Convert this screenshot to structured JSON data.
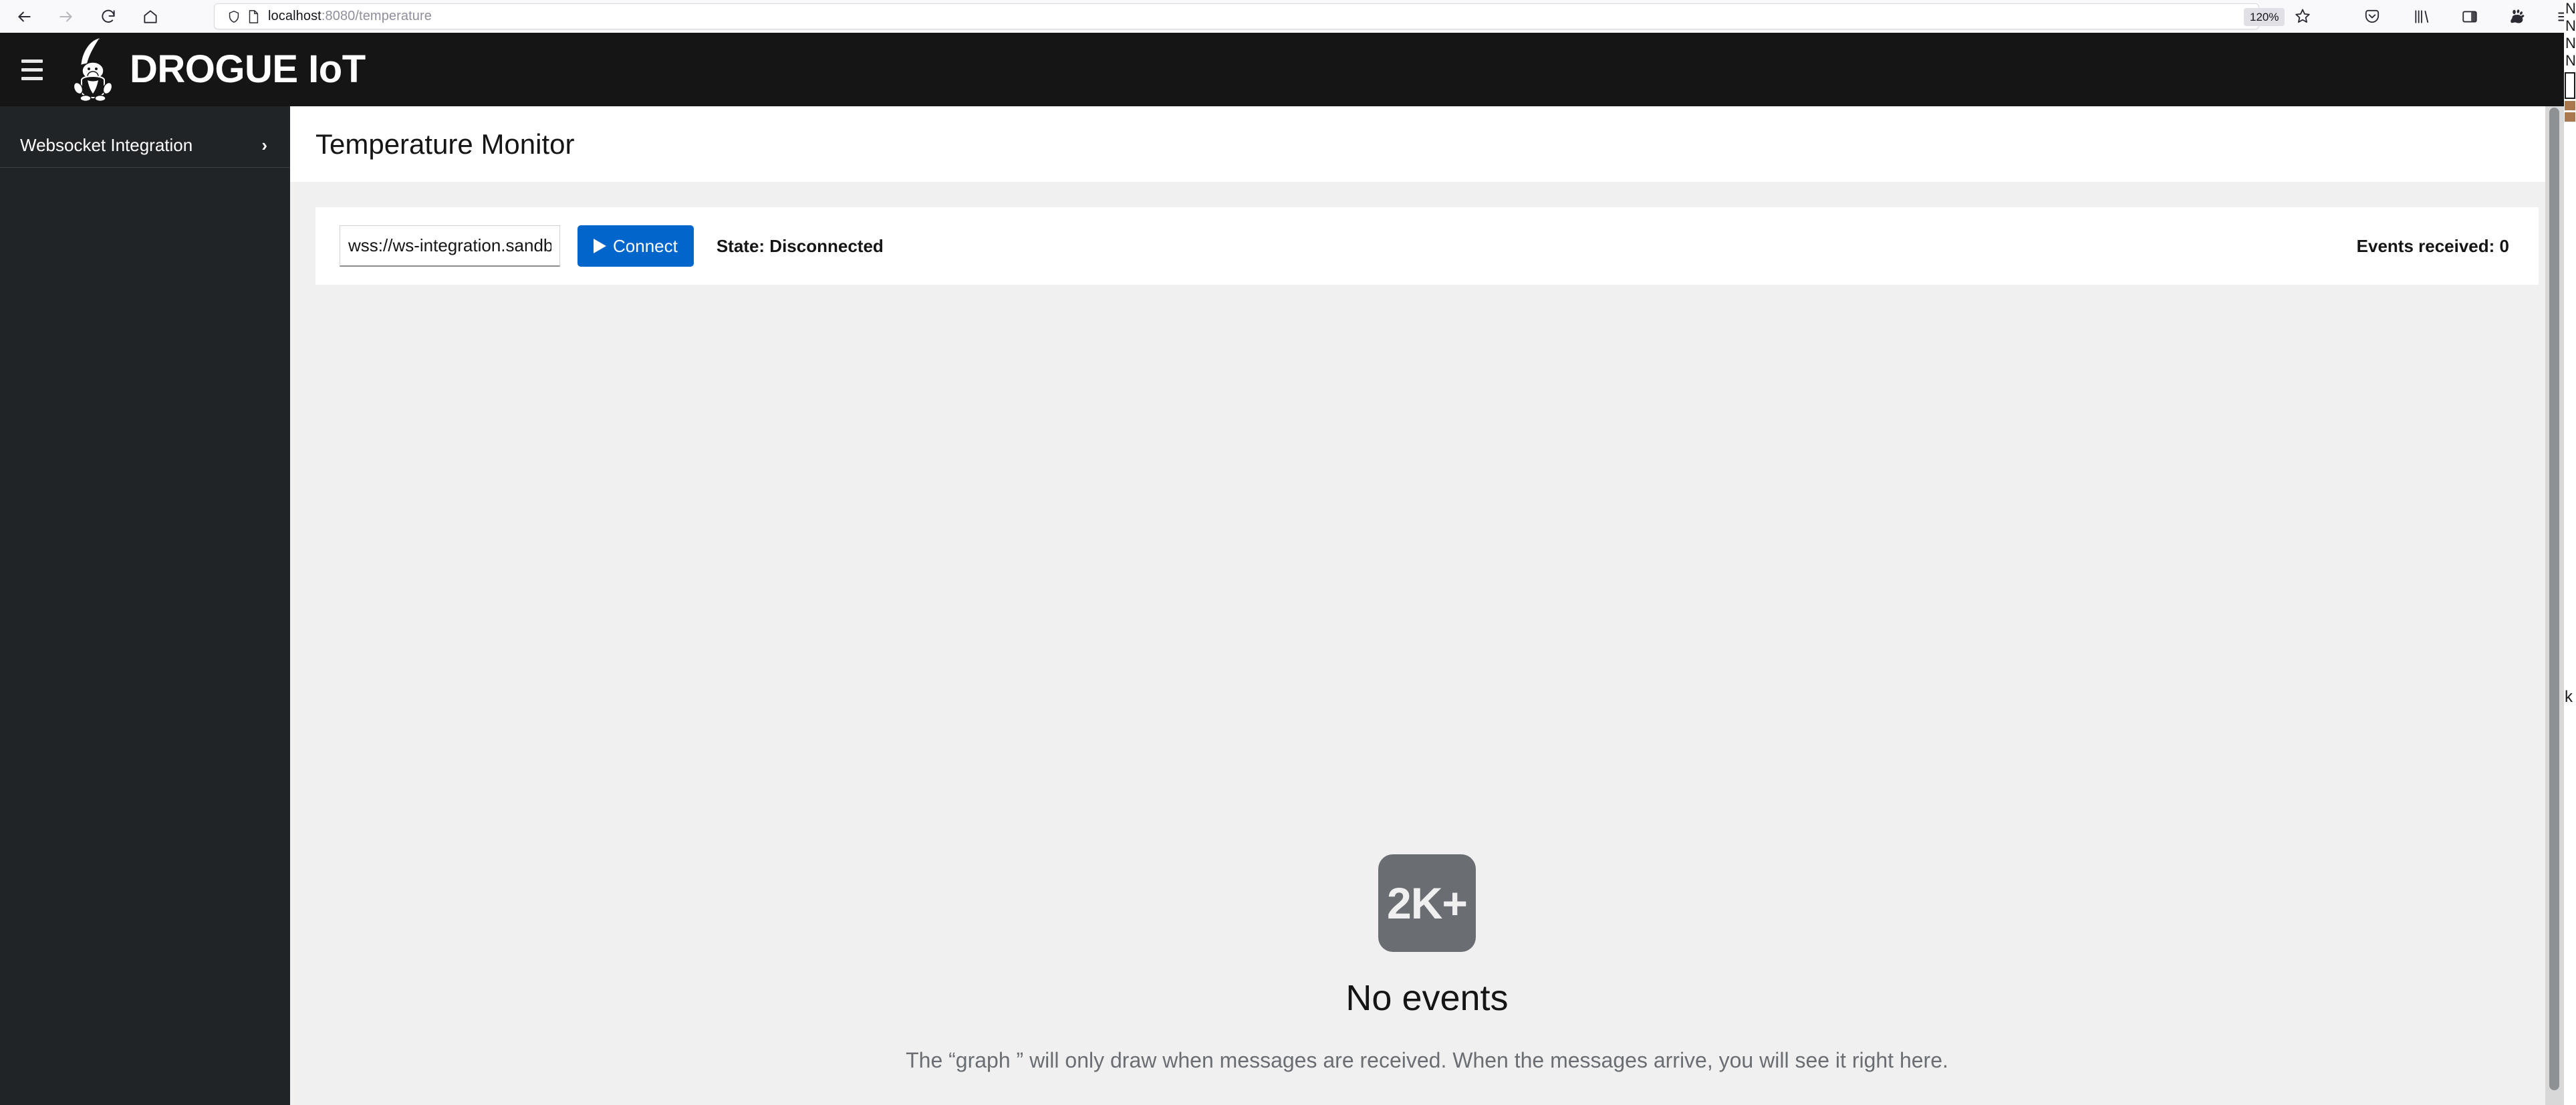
{
  "browser": {
    "back_icon": "arrow-left-icon",
    "forward_icon": "arrow-right-icon",
    "reload_icon": "reload-icon",
    "home_icon": "home-icon",
    "shield_icon": "shield-icon",
    "page_icon": "page-document-icon",
    "url_host": "localhost",
    "url_path": ":8080/temperature",
    "url_full": "localhost:8080/temperature",
    "zoom_level": "120%",
    "bookmark_icon": "star-icon",
    "toolbar_icons": [
      {
        "name": "pocket-icon"
      },
      {
        "name": "library-icon"
      },
      {
        "name": "sidebar-icon"
      },
      {
        "name": "extension-gnome-icon"
      },
      {
        "name": "hamburger-menu-icon"
      }
    ]
  },
  "background_window": {
    "lines": [
      "N",
      "N",
      "N",
      "N"
    ],
    "marker": "k"
  },
  "masthead": {
    "toggle_icon": "hamburger-toggle-icon",
    "logo_icon": "drogue-gnome-logo",
    "brand": "DROGUE IoT",
    "brand_bg": "#151515"
  },
  "sidebar": {
    "bg": "#212427",
    "items": [
      {
        "label": "Websocket Integration",
        "chevron": "›",
        "chevron_icon": "chevron-right-icon"
      }
    ]
  },
  "page": {
    "title": "Temperature Monitor",
    "toolbar": {
      "url_value": "wss://ws-integration.sandbo…",
      "url_placeholder": "wss://…",
      "connect_label": "Connect",
      "connect_icon": "play-icon",
      "connect_color": "#0066cc",
      "state_label": "State: Disconnected",
      "events_label": "Events received: 0"
    },
    "empty_state": {
      "icon_name": "filter-2k-plus-icon",
      "icon_text": "2K+",
      "icon_color": "#6a6e73",
      "title": "No events",
      "body": "The “graph ” will only draw when messages are received. When the messages arrive, you will see it right here."
    },
    "scrollbar": "vertical-scrollbar"
  }
}
